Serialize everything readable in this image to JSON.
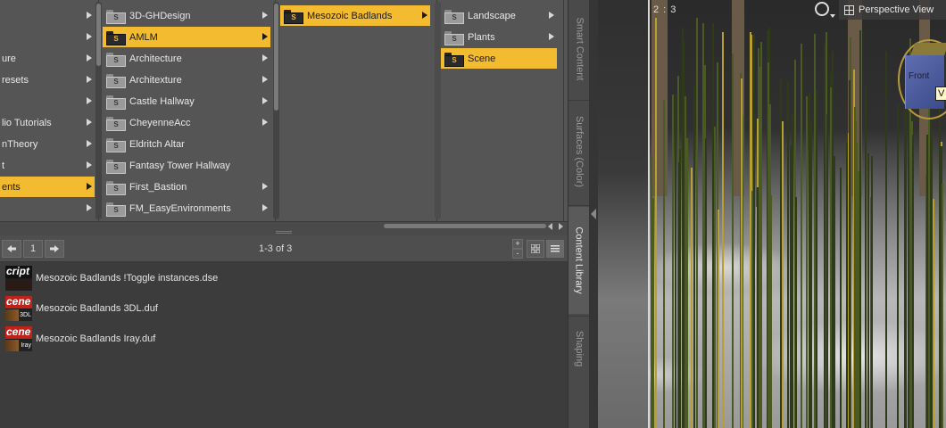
{
  "colors": {
    "selection": "#f2bb30",
    "panel": "#555555",
    "list_bg": "#3c3c3c",
    "scene_badge": "#c0221a"
  },
  "browser": {
    "col0": [
      {
        "label": "",
        "arrow": true
      },
      {
        "label": "",
        "arrow": true
      },
      {
        "label": "ure",
        "arrow": true
      },
      {
        "label": "resets",
        "arrow": true
      },
      {
        "label": "",
        "arrow": true
      },
      {
        "label": "lio Tutorials",
        "arrow": true
      },
      {
        "label": "nTheory",
        "arrow": true
      },
      {
        "label": "t",
        "arrow": true
      },
      {
        "label": "ents",
        "arrow": true,
        "selected": true
      },
      {
        "label": "",
        "arrow": true
      }
    ],
    "col1": [
      {
        "label": "3D-GHDesign",
        "arrow": true
      },
      {
        "label": "AMLM",
        "arrow": true,
        "selected": true
      },
      {
        "label": "Architecture",
        "arrow": true
      },
      {
        "label": "Architexture",
        "arrow": true
      },
      {
        "label": "Castle Hallway",
        "arrow": true
      },
      {
        "label": "CheyenneAcc",
        "arrow": true
      },
      {
        "label": "Eldritch Altar",
        "arrow": false
      },
      {
        "label": "Fantasy Tower Hallway",
        "arrow": false
      },
      {
        "label": "First_Bastion",
        "arrow": true
      },
      {
        "label": "FM_EasyEnvironments",
        "arrow": true
      }
    ],
    "col2": [
      {
        "label": "Mesozoic Badlands",
        "arrow": true,
        "selected": true
      }
    ],
    "col3": [
      {
        "label": "Landscape",
        "arrow": true
      },
      {
        "label": "Plants",
        "arrow": true
      },
      {
        "label": "Scene",
        "arrow": false,
        "selected": true
      }
    ]
  },
  "pager": {
    "prev_icon": "arrow-left-icon",
    "page": "1",
    "next_icon": "arrow-right-icon",
    "count": "1-3 of 3",
    "zoom_in": "+",
    "zoom_out": "-"
  },
  "files": [
    {
      "name": "Mesozoic Badlands !Toggle instances.dse",
      "thumb_top": "cript",
      "thumb_bottom": "",
      "kind": "script"
    },
    {
      "name": "Mesozoic Badlands 3DL.duf",
      "thumb_top": "cene",
      "thumb_bottom": "3DL",
      "kind": "scene"
    },
    {
      "name": "Mesozoic Badlands Iray.duf",
      "thumb_top": "cene",
      "thumb_bottom": "Iray",
      "kind": "scene"
    }
  ],
  "side_tabs": [
    "Smart Content",
    "Surfaces (Color)",
    "Content Library",
    "Shaping"
  ],
  "viewport": {
    "layout_label": "2 : 3",
    "title": "Perspective View",
    "cube_face": "Front",
    "tooltip": "V"
  }
}
